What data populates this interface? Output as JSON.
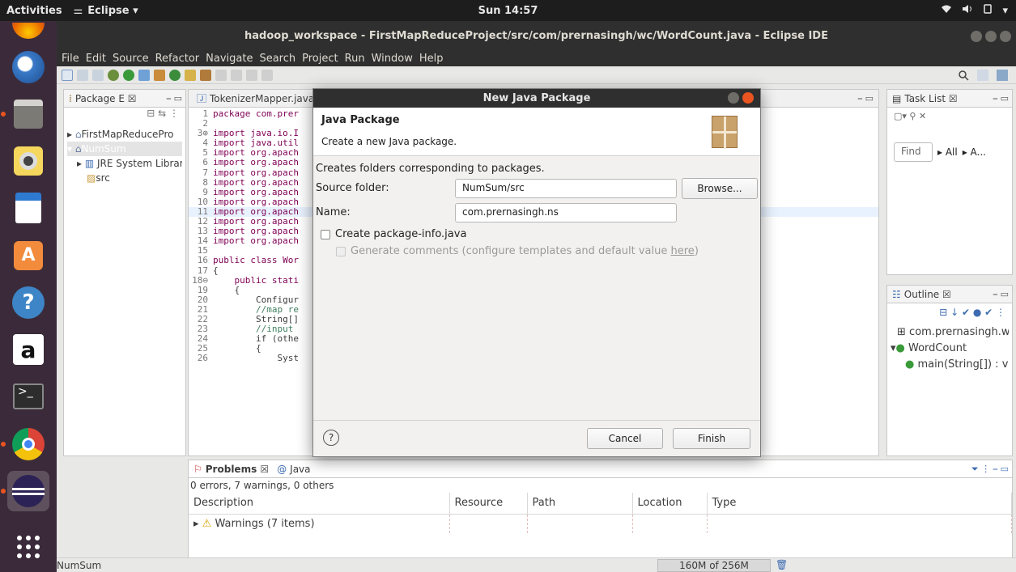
{
  "topbar": {
    "activities": "Activities",
    "app_name": "Eclipse ▾",
    "clock": "Sun 14:57"
  },
  "window": {
    "title": "hadoop_workspace - FirstMapReduceProject/src/com/prernasingh/wc/WordCount.java - Eclipse IDE"
  },
  "menu": [
    "File",
    "Edit",
    "Source",
    "Refactor",
    "Navigate",
    "Search",
    "Project",
    "Run",
    "Window",
    "Help"
  ],
  "package_explorer": {
    "tab_label": "Package E ☒",
    "items": [
      "FirstMapReducePro",
      "NumSum",
      "JRE System Librar",
      "src"
    ]
  },
  "editor": {
    "tab_label": "TokenizerMapper.java",
    "lines": [
      {
        "n": "1",
        "t": "package com.prer"
      },
      {
        "n": "2",
        "t": ""
      },
      {
        "n": "3⊕",
        "t": "import java.io.I"
      },
      {
        "n": "4",
        "t": "import java.util"
      },
      {
        "n": "5",
        "t": "import org.apach"
      },
      {
        "n": "6",
        "t": "import org.apach"
      },
      {
        "n": "7",
        "t": "import org.apach"
      },
      {
        "n": "8",
        "t": "import org.apach"
      },
      {
        "n": "9",
        "t": "import org.apach"
      },
      {
        "n": "10",
        "t": "import org.apach"
      },
      {
        "n": "11",
        "t": "import org.apach"
      },
      {
        "n": "12",
        "t": "import org.apach"
      },
      {
        "n": "13",
        "t": "import org.apach"
      },
      {
        "n": "14",
        "t": "import org.apach"
      },
      {
        "n": "15",
        "t": ""
      },
      {
        "n": "16",
        "t": "public class Wor"
      },
      {
        "n": "17",
        "t": "{"
      },
      {
        "n": "18⊖",
        "t": "    public stati"
      },
      {
        "n": "19",
        "t": "    {"
      },
      {
        "n": "20",
        "t": "        Configur"
      },
      {
        "n": "21",
        "t": "        //map re"
      },
      {
        "n": "22",
        "t": "        String[]"
      },
      {
        "n": "23",
        "t": "        //input"
      },
      {
        "n": "24",
        "t": "        if (othe"
      },
      {
        "n": "25",
        "t": "        {"
      },
      {
        "n": "26",
        "t": "            Syst"
      }
    ]
  },
  "tasks": {
    "tab_label": "Task List ☒",
    "find_placeholder": "Find",
    "filter_all": "▸ All",
    "filter_a": "▸ A..."
  },
  "outline": {
    "tab_label": "Outline ☒",
    "items": [
      "com.prernasingh.wc",
      "WordCount",
      "main(String[]) : vc"
    ]
  },
  "problems": {
    "tab_problems": "Problems ☒",
    "tab_java": "Java",
    "summary": "0 errors, 7 warnings, 0 others",
    "columns": [
      "Description",
      "Resource",
      "Path",
      "Location",
      "Type"
    ],
    "rows": [
      {
        "description": "Warnings (7 items)"
      }
    ]
  },
  "status": {
    "project": "NumSum",
    "heap": "160M of 256M"
  },
  "dialog": {
    "title": "New Java Package",
    "header": "Java Package",
    "subheader": "Create a new Java package.",
    "description": "Creates folders corresponding to packages.",
    "source_folder_label": "Source folder:",
    "source_folder_value": "NumSum/src",
    "browse_label": "Browse...",
    "name_label": "Name:",
    "name_value": "com.prernasingh.ns",
    "create_info_label": "Create package-info.java",
    "generate_comments_label": "Generate comments",
    "configure_text": "(configure templates and default value",
    "here_link": "here",
    "configure_close": ")",
    "help_icon_text": "?",
    "cancel_label": "Cancel",
    "finish_label": "Finish"
  },
  "colors": {
    "accent": "#e95420",
    "keyword": "#7f0055",
    "comment": "#3f7f5f",
    "dock": "#3b2b3a",
    "titlebar": "#2f2f2f"
  }
}
